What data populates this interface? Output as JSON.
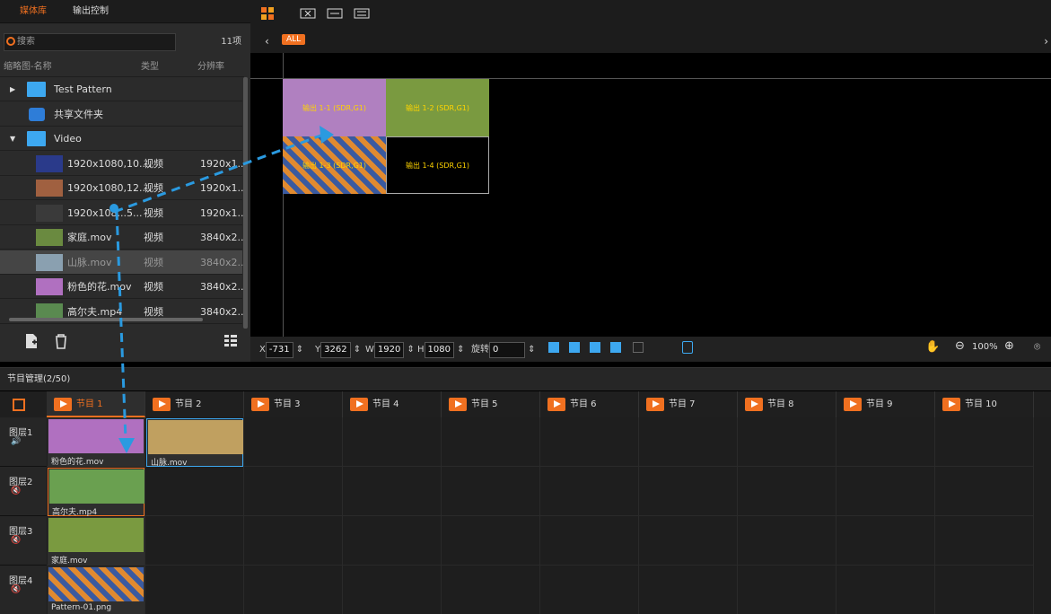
{
  "media_tabs": [
    "媒体库",
    "输出控制"
  ],
  "search": {
    "placeholder": "搜索",
    "count": "11项"
  },
  "columns": {
    "name": "缩略图-名称",
    "type": "类型",
    "resolution": "分辨率"
  },
  "media_rows": [
    {
      "kind": "folder",
      "name": "Test Pattern",
      "expand": "collapsed"
    },
    {
      "kind": "shared",
      "name": "共享文件夹"
    },
    {
      "kind": "folder",
      "name": "Video",
      "expand": "expanded"
    },
    {
      "kind": "file",
      "name": "1920x1080,10....",
      "type": "视频",
      "res": "1920x1...",
      "thumb": "#2a3a8a"
    },
    {
      "kind": "file",
      "name": "1920x1080,12....",
      "type": "视频",
      "res": "1920x1...",
      "thumb": "#a06040"
    },
    {
      "kind": "file",
      "name": "1920x108...5...",
      "type": "视频",
      "res": "1920x1...",
      "thumb": "#3a3a3a"
    },
    {
      "kind": "file",
      "name": "家庭.mov",
      "type": "视频",
      "res": "3840x2...",
      "thumb": "#6a8a40"
    },
    {
      "kind": "file",
      "name": "山脉.mov",
      "type": "视频",
      "res": "3840x2...",
      "thumb": "#8aa0b0",
      "selected": true
    },
    {
      "kind": "file",
      "name": "粉色的花.mov",
      "type": "视频",
      "res": "3840x2...",
      "thumb": "#b070c0"
    },
    {
      "kind": "file",
      "name": "高尔夫.mp4",
      "type": "视频",
      "res": "3840x2...",
      "thumb": "#5a8a50"
    }
  ],
  "preview": {
    "all_tag": "ALL",
    "tiles": [
      {
        "label": "输出 1-1 (SDR,G1)",
        "bg": "#b080c0"
      },
      {
        "label": "输出 1-2 (SDR,G1)",
        "bg": "#7a9a40"
      },
      {
        "label": "输出 1-3 (SDR,G1)",
        "bg": "#e08a30"
      },
      {
        "label": "输出 1-4 (SDR,G1)",
        "bg": "#000000"
      }
    ],
    "toolbar": {
      "x": "-731",
      "y": "3262",
      "w": "1920",
      "h": "1080",
      "rotate_label": "旋转",
      "rotate": "0",
      "zoom": "100%"
    }
  },
  "program": {
    "header": "节目管理(2/50)",
    "tabs": [
      "节目 1",
      "节目 2",
      "节目 3",
      "节目 4",
      "节目 5",
      "节目 6",
      "节目 7",
      "节目 8",
      "节目 9",
      "节目 10"
    ],
    "active_tab": 0,
    "layers": [
      "图层1",
      "图层2",
      "图层3",
      "图层4"
    ],
    "clips": [
      {
        "layer": 0,
        "col": 0,
        "name": "粉色的花.mov",
        "bg": "#b070c0"
      },
      {
        "layer": 0,
        "col": 1,
        "name": "山脉.mov",
        "bg": "#c0a060"
      },
      {
        "layer": 1,
        "col": 0,
        "name": "高尔夫.mp4",
        "bg": "#6aa050"
      },
      {
        "layer": 2,
        "col": 0,
        "name": "家庭.mov",
        "bg": "#7a9a40"
      },
      {
        "layer": 3,
        "col": 0,
        "name": "Pattern-01.png",
        "bg": "#e08a30"
      }
    ]
  },
  "colors": {
    "accent": "#f07020",
    "folder": "#3da8f0",
    "drag_line": "#2a9ae0"
  }
}
